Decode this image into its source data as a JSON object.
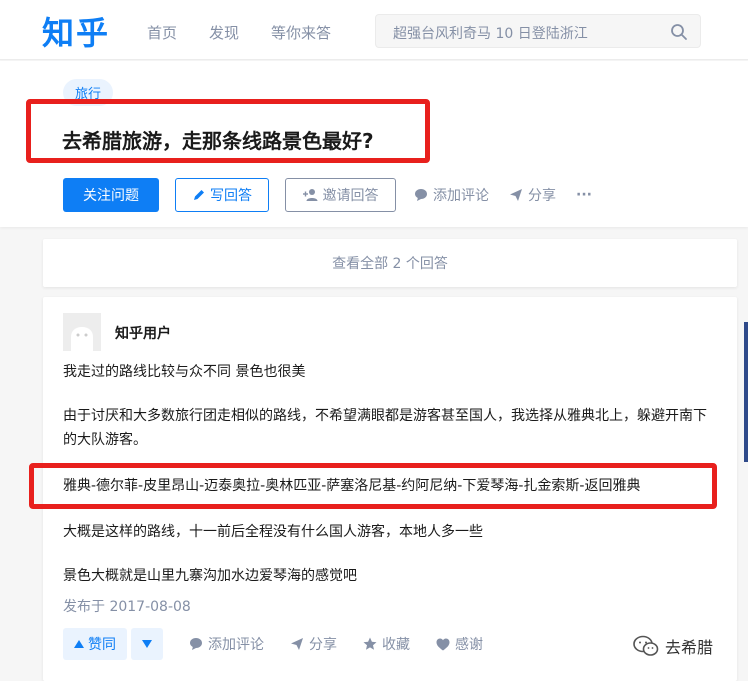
{
  "header": {
    "logo": "知乎",
    "nav": [
      "首页",
      "发现",
      "等你来答"
    ],
    "search_text": "超强台风利奇马 10 日登陆浙江",
    "search_icon": "search-icon"
  },
  "question": {
    "topic": "旅行",
    "title": "去希腊旅游，走那条线路景色最好?",
    "actions": {
      "follow": "关注问题",
      "write": "写回答",
      "invite": "邀请回答",
      "comment": "添加评论",
      "share": "分享",
      "more": "···"
    }
  },
  "view_all": "查看全部 2 个回答",
  "answer": {
    "author": "知乎用户",
    "paragraphs": [
      "我走过的路线比较与众不同 景色也很美",
      "由于讨厌和大多数旅行团走相似的路线，不希望满眼都是游客甚至国人，我选择从雅典北上，躲避开南下的大队游客。",
      "雅典-德尔菲-皮里昂山-迈泰奥拉-奥林匹亚-萨塞洛尼基-约阿尼纳-下爱琴海-扎金索斯-返回雅典",
      "大概是这样的路线，十一前后全程没有什么国人游客，本地人多一些",
      "景色大概就是山里九寨沟加水边爱琴海的感觉吧"
    ],
    "date": "发布于 2017-08-08",
    "actions": {
      "upvote": "赞同",
      "comment": "添加评论",
      "share": "分享",
      "collect": "收藏",
      "thanks": "感谢"
    }
  },
  "watermark": "去希腊",
  "colors": {
    "brand": "#0e7ef5",
    "highlight": "#e8201d",
    "muted": "#8590a6"
  }
}
